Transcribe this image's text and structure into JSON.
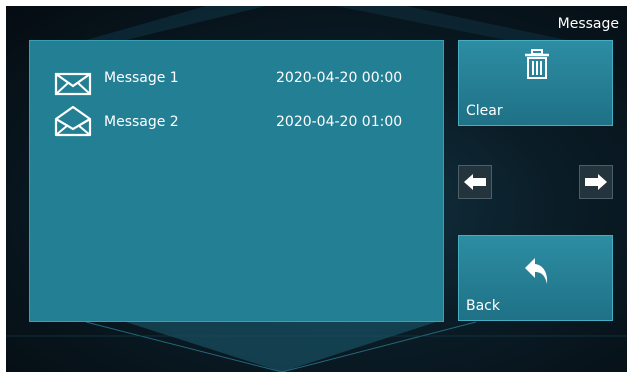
{
  "header": {
    "title": "Message"
  },
  "messages": [
    {
      "name": "Message 1",
      "time": "2020-04-20 00:00",
      "icon": "envelope-closed-icon"
    },
    {
      "name": "Message 2",
      "time": "2020-04-20 01:00",
      "icon": "envelope-open-icon"
    }
  ],
  "buttons": {
    "clear_label": "Clear",
    "clear_icon": "trash-icon",
    "back_label": "Back",
    "back_icon": "back-arrow-icon",
    "prev_icon": "arrow-left-icon",
    "next_icon": "arrow-right-icon"
  },
  "colors": {
    "panel": "#237f93",
    "tile": "#2d8da3",
    "background": "#0a1c26"
  }
}
